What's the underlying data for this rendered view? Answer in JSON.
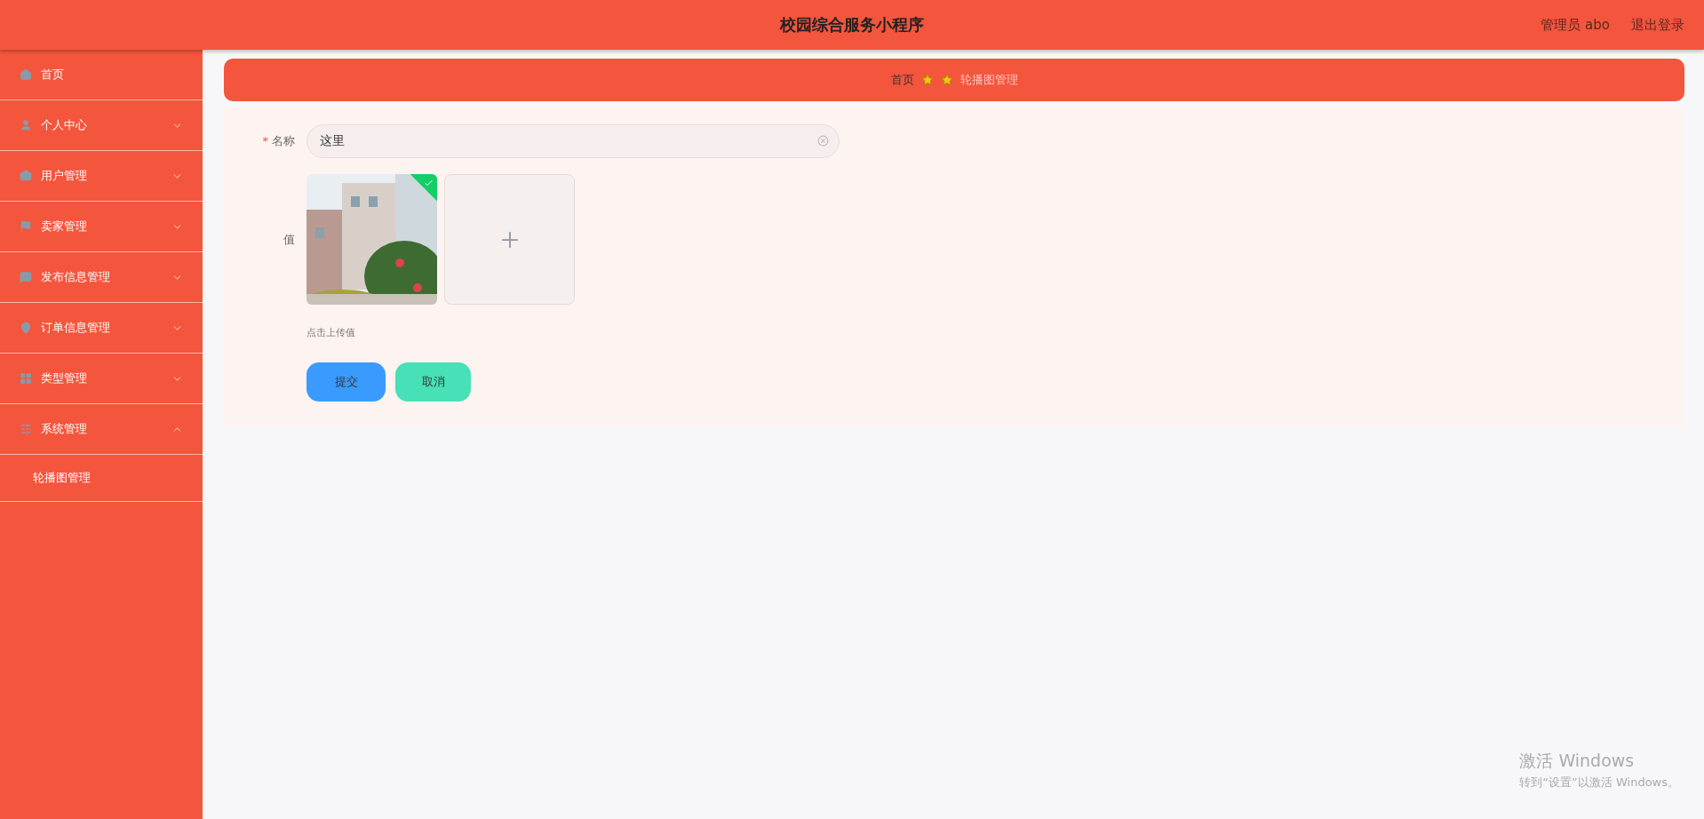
{
  "header": {
    "title": "校园综合服务小程序",
    "user": "管理员 abo",
    "logout": "退出登录"
  },
  "sidebar": {
    "items": [
      {
        "kind": "link",
        "label": "首页"
      },
      {
        "kind": "menu",
        "label": "个人中心",
        "expanded": false
      },
      {
        "kind": "menu",
        "label": "用户管理",
        "expanded": false
      },
      {
        "kind": "menu",
        "label": "卖家管理",
        "expanded": false
      },
      {
        "kind": "menu",
        "label": "发布信息管理",
        "expanded": false
      },
      {
        "kind": "menu",
        "label": "订单信息管理",
        "expanded": false
      },
      {
        "kind": "menu",
        "label": "类型管理",
        "expanded": false
      },
      {
        "kind": "menu",
        "label": "系统管理",
        "expanded": true,
        "children": [
          {
            "label": "轮播图管理"
          }
        ]
      }
    ]
  },
  "breadcrumb": [
    {
      "label": "首页",
      "selected": false
    },
    {
      "label": "轮播图管理",
      "selected": true
    }
  ],
  "form": {
    "name": {
      "label": "名称",
      "required_mark": "*",
      "value": "这里"
    },
    "value": {
      "label": "值",
      "images": [
        {
          "kind": "picture",
          "uploaded": true
        }
      ],
      "hint": "点击上传值"
    },
    "buttons": [
      {
        "kind": "primary",
        "label": "提交"
      },
      {
        "kind": "secondary",
        "label": "取消"
      }
    ]
  },
  "os_notice": {
    "title": "激活 Windows",
    "text": "转到“设置”以激活 Windows。"
  }
}
